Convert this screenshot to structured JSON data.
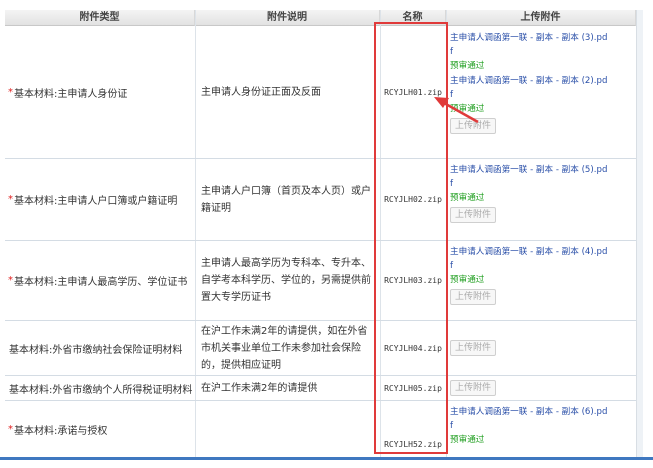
{
  "table": {
    "headers": [
      "附件类型",
      "附件说明",
      "名称",
      "上传附件"
    ],
    "rows": [
      {
        "required": "*",
        "type": "基本材料:主申请人身份证",
        "desc": "主申请人身份证正面及反面",
        "name": "RCYJLH01.zip",
        "uploads": [
          {
            "file": "主申请人调函第一联 - 副本 - 副本 (3).pd",
            "ext": "f",
            "status": "预审通过"
          },
          {
            "file": "主申请人调函第一联 - 副本 - 副本 (2).pd",
            "ext": "f",
            "status": "预审通过"
          }
        ],
        "button": "上传附件"
      },
      {
        "required": "*",
        "type": "基本材料:主申请人户口簿或户籍证明",
        "desc": "主申请人户口簿（首页及本人页）或户籍证明",
        "name": "RCYJLH02.zip",
        "uploads": [
          {
            "file": "主申请人调函第一联 - 副本 - 副本 (5).pd",
            "ext": "f",
            "status": "预审通过"
          }
        ],
        "button": "上传附件"
      },
      {
        "required": "*",
        "type": "基本材料:主申请人最高学历、学位证书",
        "desc": "主申请人最高学历为专科本、专升本、自学考本科学历、学位的，另需提供前置大专学历证书",
        "name": "RCYJLH03.zip",
        "uploads": [
          {
            "file": "主申请人调函第一联 - 副本 - 副本 (4).pd",
            "ext": "f",
            "status": "预审通过"
          }
        ],
        "button": "上传附件"
      },
      {
        "required": "",
        "type": "基本材料:外省市缴纳社会保险证明材料",
        "desc": "在沪工作未满2年的请提供，如在外省市机关事业单位工作未参加社会保险的，提供相应证明",
        "name": "RCYJLH04.zip",
        "uploads": [],
        "button": "上传附件"
      },
      {
        "required": "",
        "type": "基本材料:外省市缴纳个人所得税证明材料",
        "desc": "在沪工作未满2年的请提供",
        "name": "RCYJLH05.zip",
        "uploads": [],
        "button": "上传附件"
      },
      {
        "required": "*",
        "type": "基本材料:承诺与授权",
        "desc": "",
        "name": "RCYJLH52.zip",
        "uploads": [
          {
            "file": "主申请人调函第一联 - 副本 - 副本 (6).pd",
            "ext": "f",
            "status": "预审通过"
          }
        ],
        "button": ""
      }
    ]
  },
  "colors": {
    "required_star": "#e02020",
    "link": "#2a4fa8",
    "passed": "#1f9e1f",
    "highlight_box": "#e03a3a"
  }
}
